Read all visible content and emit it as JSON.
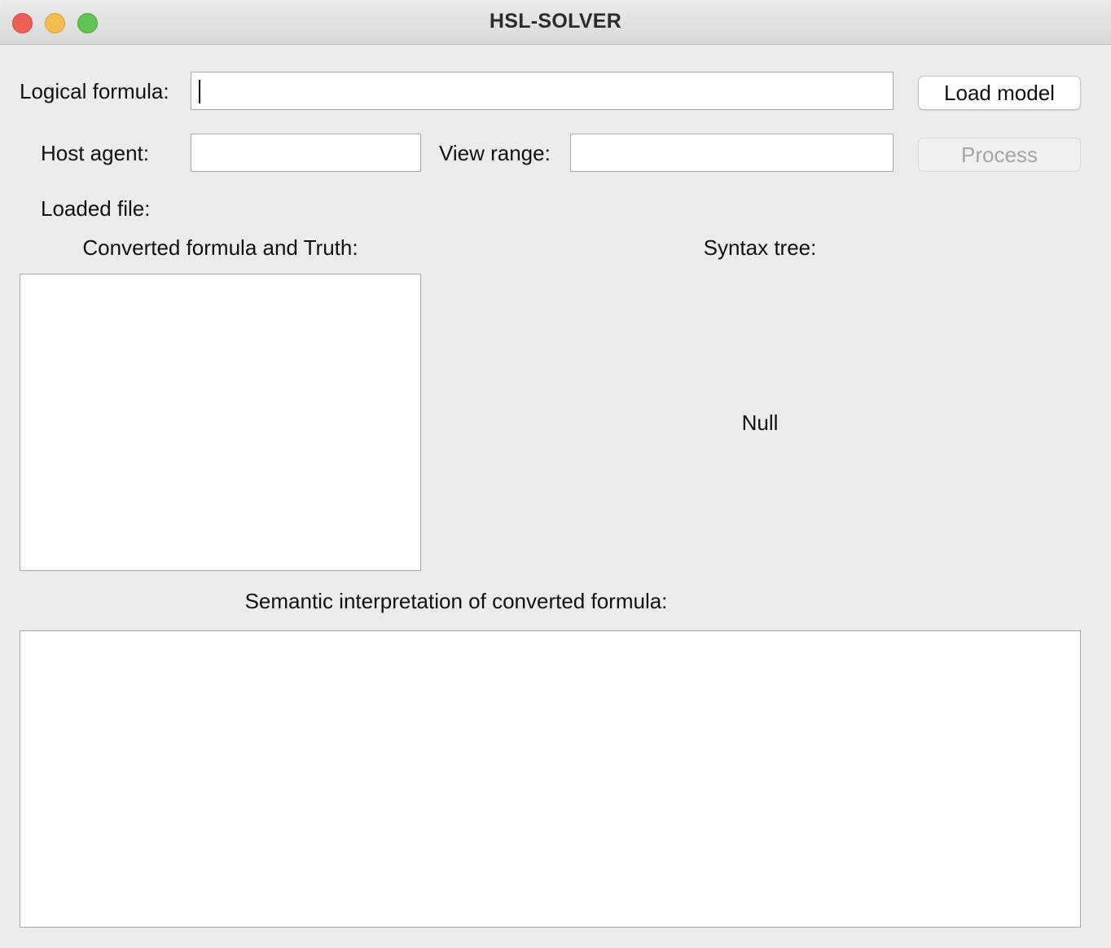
{
  "window": {
    "title": "HSL-SOLVER"
  },
  "form": {
    "logical_formula_label": "Logical formula:",
    "logical_formula_value": "",
    "load_model_button": "Load model",
    "host_agent_label": "Host agent:",
    "host_agent_value": "",
    "view_range_label": "View range:",
    "view_range_value": "",
    "process_button": "Process",
    "loaded_file_label": "Loaded file:"
  },
  "panels": {
    "converted_label": "Converted formula and Truth:",
    "syntax_tree_label": "Syntax tree:",
    "syntax_tree_value": "Null",
    "semantic_label": "Semantic interpretation of converted formula:"
  },
  "colors": {
    "close": "#ee5f57",
    "minimize": "#f5bd4f",
    "maximize": "#61c555",
    "window_bg": "#ececec"
  }
}
